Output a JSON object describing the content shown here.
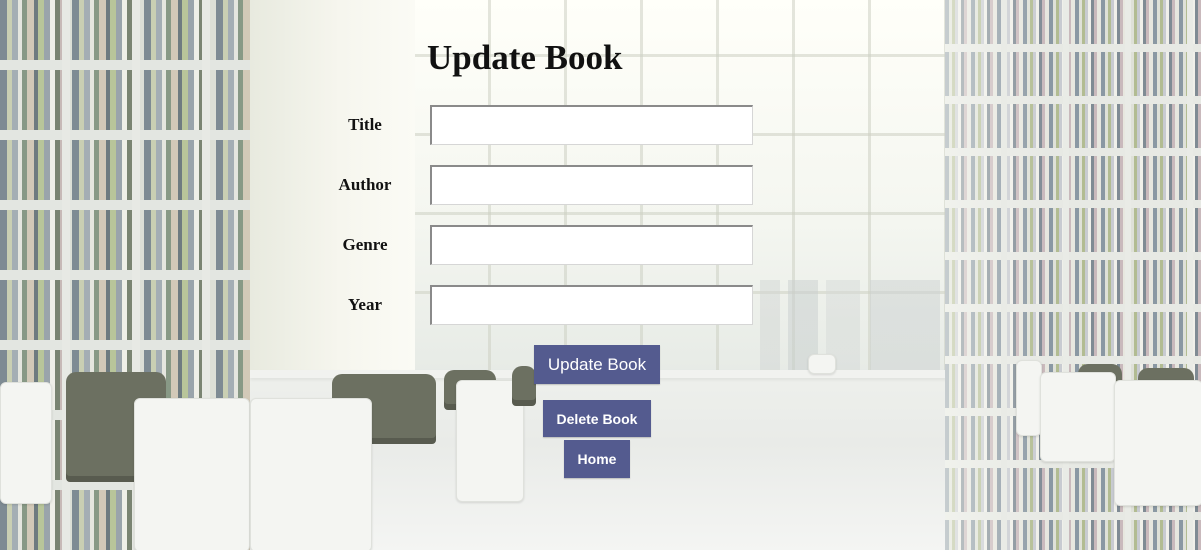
{
  "page": {
    "title": "Update Book"
  },
  "form": {
    "fields": [
      {
        "label": "Title",
        "value": "",
        "placeholder": ""
      },
      {
        "label": "Author",
        "value": "",
        "placeholder": ""
      },
      {
        "label": "Genre",
        "value": "",
        "placeholder": ""
      },
      {
        "label": "Year",
        "value": "",
        "placeholder": ""
      }
    ]
  },
  "buttons": {
    "update_label": "Update Book",
    "delete_label": "Delete Book",
    "home_label": "Home"
  },
  "colors": {
    "button_bg": "#545b8f",
    "button_text": "#ffffff",
    "text": "#111111"
  }
}
